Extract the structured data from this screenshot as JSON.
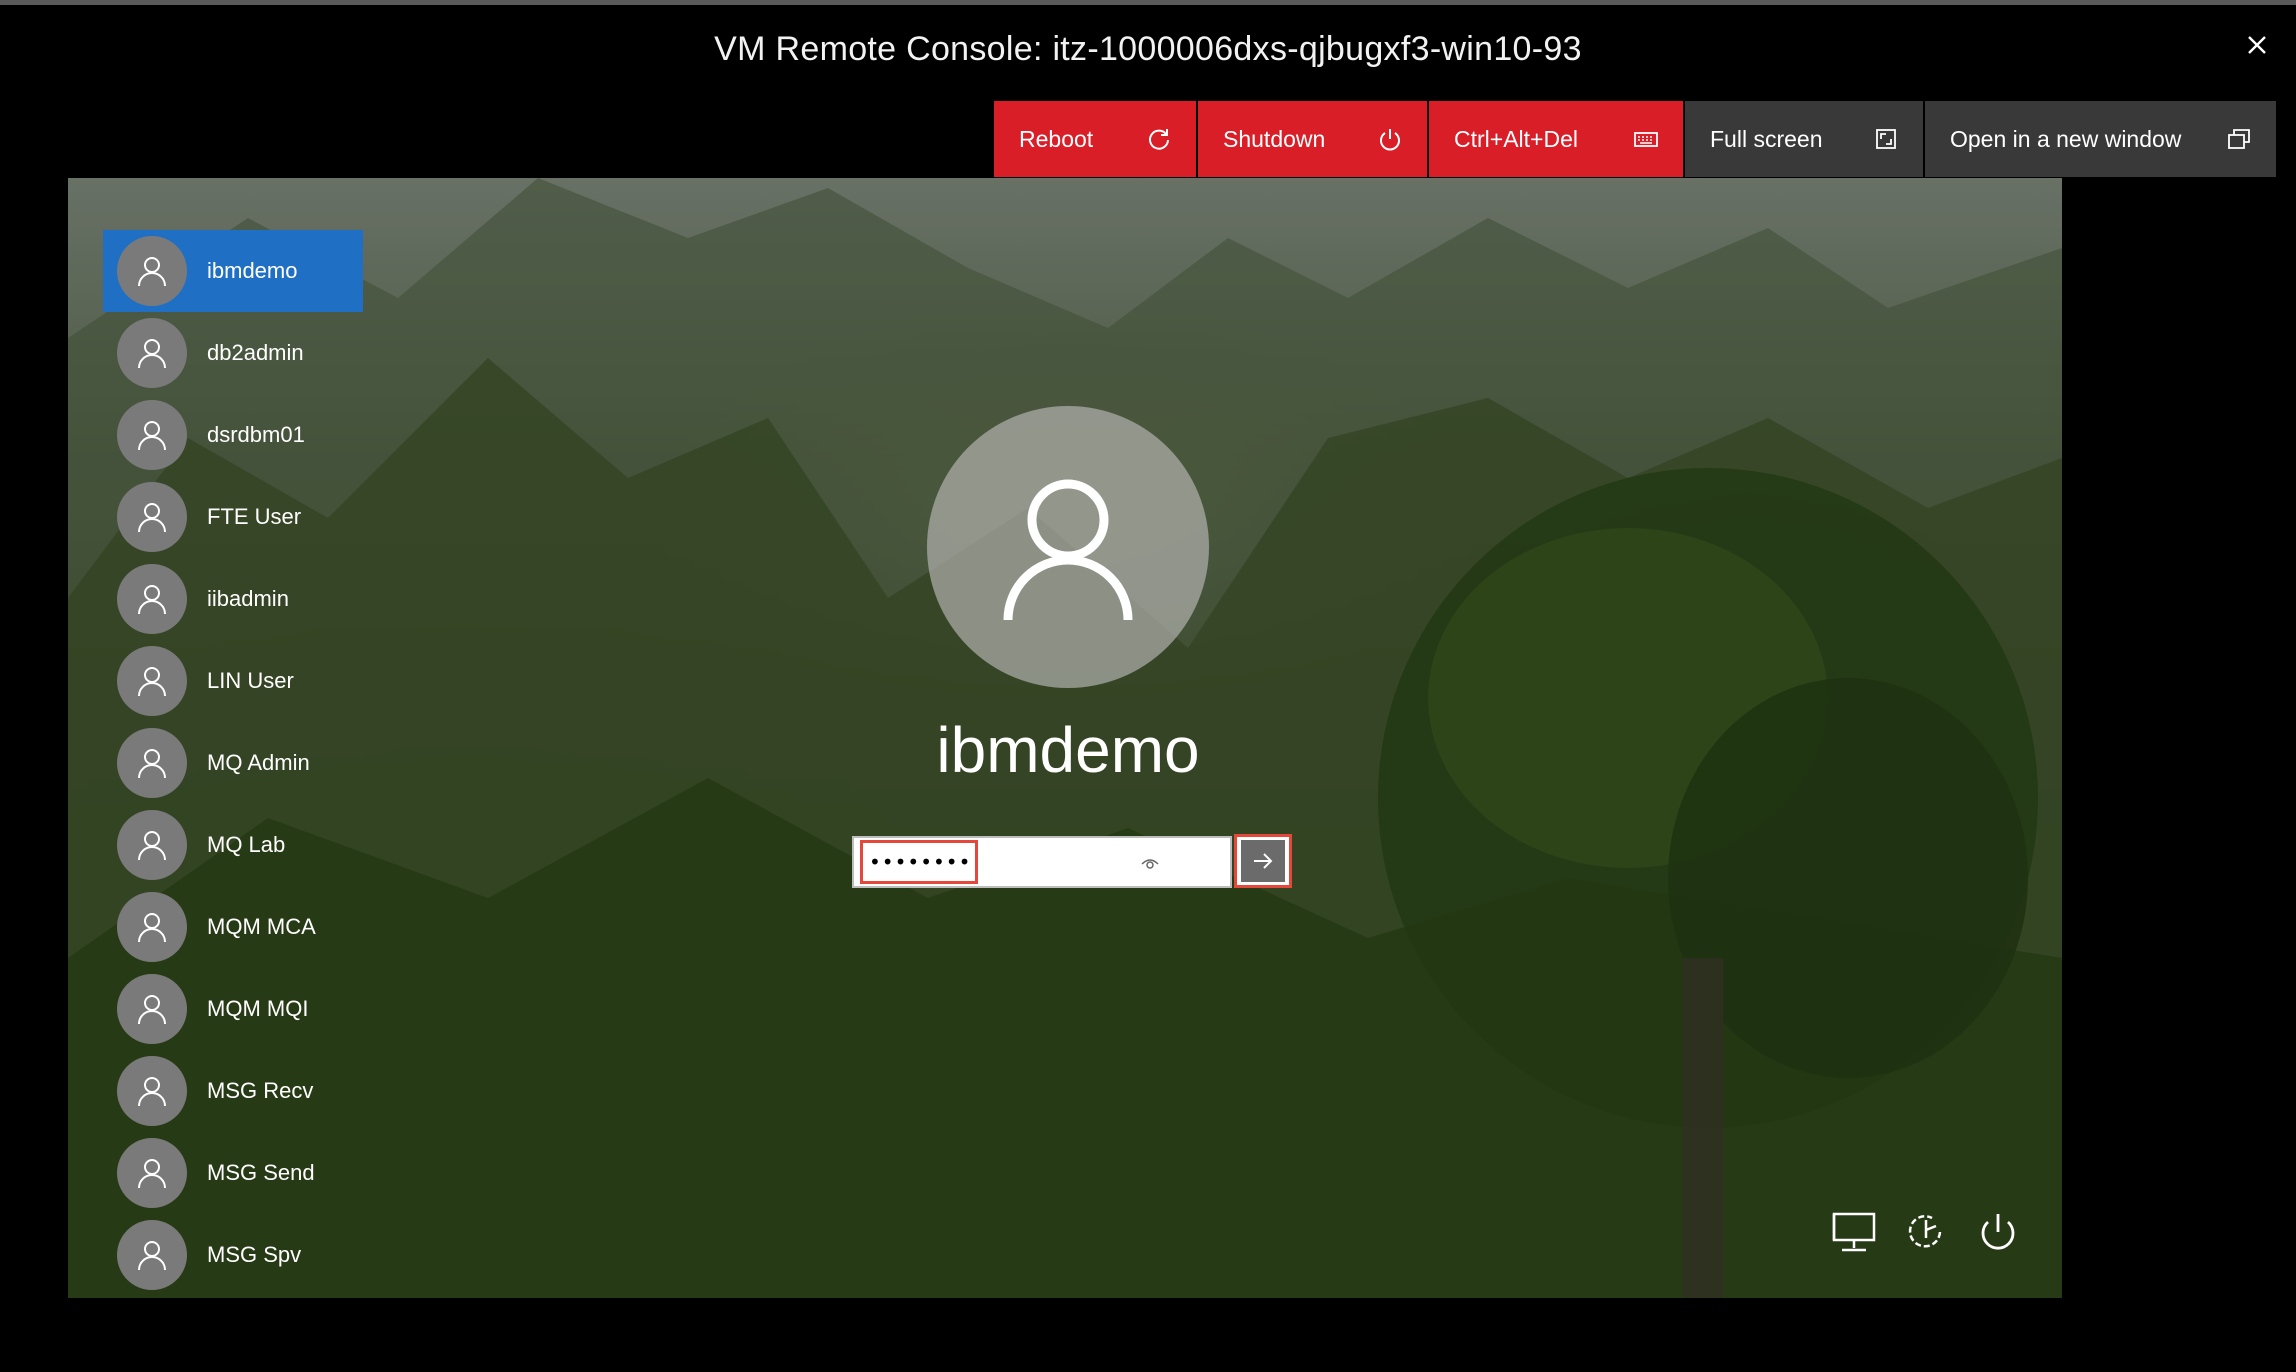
{
  "window": {
    "title": "VM Remote Console: itz-1000006dxs-qjbugxf3-win10-93"
  },
  "toolbar": {
    "buttons": [
      {
        "label": "Reboot",
        "icon": "restart-icon",
        "style": "red"
      },
      {
        "label": "Shutdown",
        "icon": "power-icon",
        "style": "red"
      },
      {
        "label": "Ctrl+Alt+Del",
        "icon": "keyboard-icon",
        "style": "red"
      },
      {
        "label": "Full screen",
        "icon": "fullscreen-icon",
        "style": "gray"
      },
      {
        "label": "Open in a new window",
        "icon": "new-window-icon",
        "style": "gray"
      }
    ]
  },
  "login": {
    "users": [
      {
        "name": "ibmdemo",
        "selected": true
      },
      {
        "name": "db2admin"
      },
      {
        "name": "dsrdbm01"
      },
      {
        "name": "FTE User"
      },
      {
        "name": "iibadmin"
      },
      {
        "name": "LIN User"
      },
      {
        "name": "MQ Admin"
      },
      {
        "name": "MQ Lab"
      },
      {
        "name": "MQM MCA"
      },
      {
        "name": "MQM MQI"
      },
      {
        "name": "MSG Recv"
      },
      {
        "name": "MSG Send"
      },
      {
        "name": "MSG Spv"
      }
    ],
    "selected_user": "ibmdemo",
    "password_value": "••••••••",
    "bottom_icons": [
      "network-icon",
      "accessibility-icon",
      "power-icon"
    ]
  },
  "colors": {
    "toolbar_red": "#da1e28",
    "toolbar_gray": "#393939",
    "selected_user": "#1f6fc5",
    "highlight_box": "#e5483a"
  }
}
